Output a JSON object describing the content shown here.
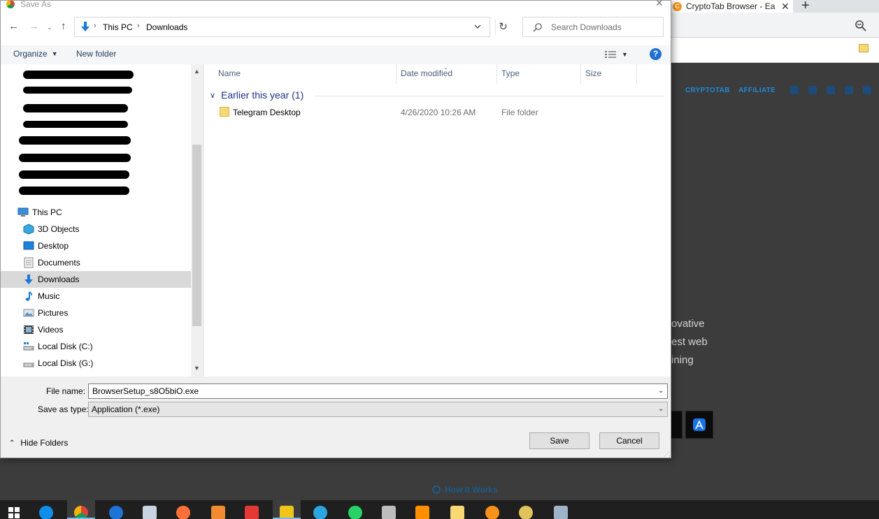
{
  "browser": {
    "tab_title": "CryptoTab Browser - Ea",
    "tab_favicon": "cryptotab-icon",
    "nav_links": [
      "CRYPTOTAB",
      "AFFILIATE"
    ],
    "social_icons": [
      "facebook-icon",
      "telegram-icon",
      "twitter-icon",
      "instagram-icon",
      "vk-icon"
    ],
    "body_fragments": [
      "ovative",
      "est web",
      "ining"
    ],
    "how_it_works": "How It Works"
  },
  "dialog": {
    "title": "Save As",
    "address": {
      "crumbs": [
        "This PC",
        "Downloads"
      ]
    },
    "search": {
      "placeholder": "Search Downloads"
    },
    "toolbar": {
      "organize_label": "Organize",
      "new_folder_label": "New folder",
      "help_label": "?"
    },
    "nav": {
      "this_pc": "This PC",
      "items": [
        {
          "label": "3D Objects",
          "icon": "3d-objects-icon"
        },
        {
          "label": "Desktop",
          "icon": "desktop-icon"
        },
        {
          "label": "Documents",
          "icon": "documents-icon"
        },
        {
          "label": "Downloads",
          "icon": "downloads-icon",
          "selected": true
        },
        {
          "label": "Music",
          "icon": "music-icon"
        },
        {
          "label": "Pictures",
          "icon": "pictures-icon"
        },
        {
          "label": "Videos",
          "icon": "videos-icon"
        },
        {
          "label": "Local Disk (C:)",
          "icon": "drive-icon"
        },
        {
          "label": "Local Disk (G:)",
          "icon": "drive-icon"
        }
      ]
    },
    "columns": [
      "Name",
      "Date modified",
      "Type",
      "Size"
    ],
    "group_label": "Earlier this year (1)",
    "files": [
      {
        "name": "Telegram Desktop",
        "date": "4/26/2020 10:26 AM",
        "type": "File folder",
        "size": ""
      }
    ],
    "file_name_label": "File name:",
    "file_name_value": "BrowserSetup_s8O5biO.exe",
    "save_type_label": "Save as type:",
    "save_type_value": "Application (*.exe)",
    "hide_folders_label": "Hide Folders",
    "save_label": "Save",
    "cancel_label": "Cancel"
  },
  "taskbar": {
    "apps": [
      "windows-start-icon",
      "teamviewer-icon",
      "chrome-icon",
      "edge-icon",
      "notepad-icon",
      "firefox-icon",
      "code-editor-icon",
      "shield-app-icon",
      "file-manager-icon",
      "telegram-icon",
      "whatsapp-icon",
      "calculator-icon",
      "media-player-icon",
      "file-explorer-icon",
      "cryptotab-icon",
      "app-icon",
      "task-manager-icon"
    ]
  },
  "colors": {
    "accent": "#1d6fd1",
    "group_header": "#1e3287",
    "site_link": "#1f8ad6"
  }
}
